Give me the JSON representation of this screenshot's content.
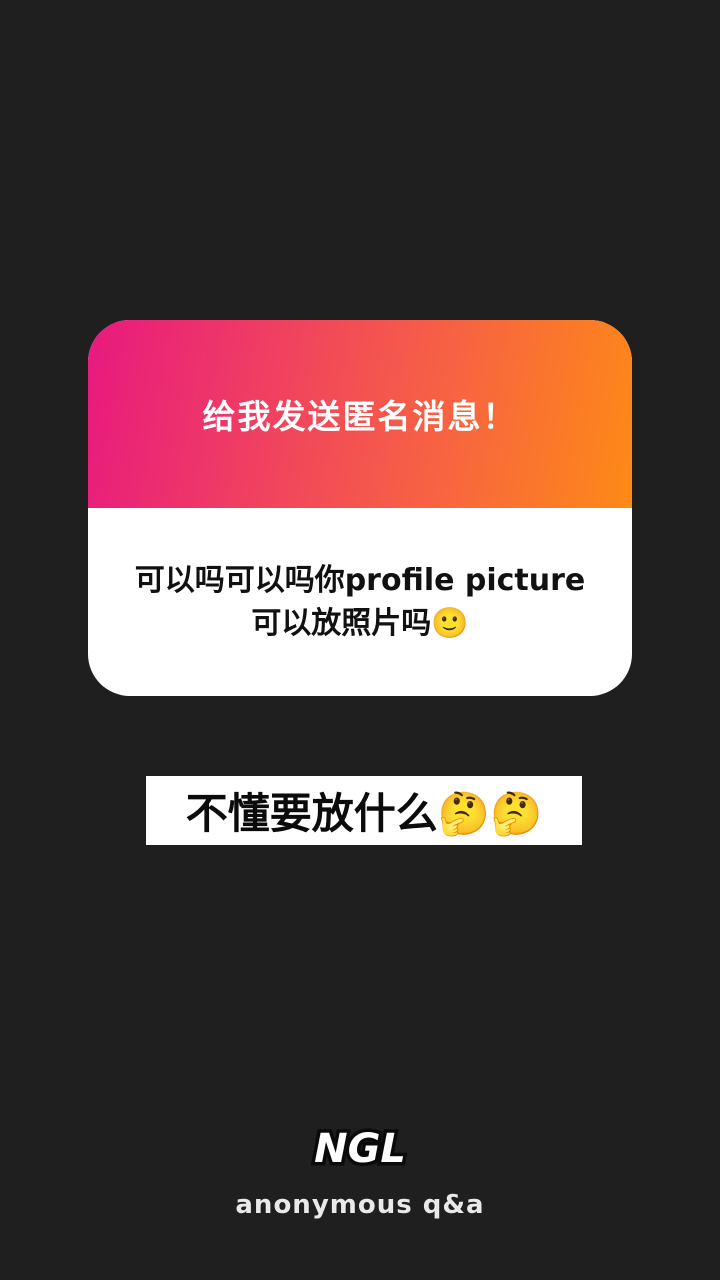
{
  "card": {
    "header": "给我发送匿名消息！",
    "body": "可以吗可以吗你profile picture可以放照片吗🙂"
  },
  "reply": {
    "text": "不懂要放什么🤔🤔"
  },
  "branding": {
    "logo_text": "NGL",
    "tagline": "anonymous q&a"
  },
  "colors": {
    "background": "#1f1f1f",
    "gradient_start": "#e8197f",
    "gradient_end": "#fe8a16"
  }
}
